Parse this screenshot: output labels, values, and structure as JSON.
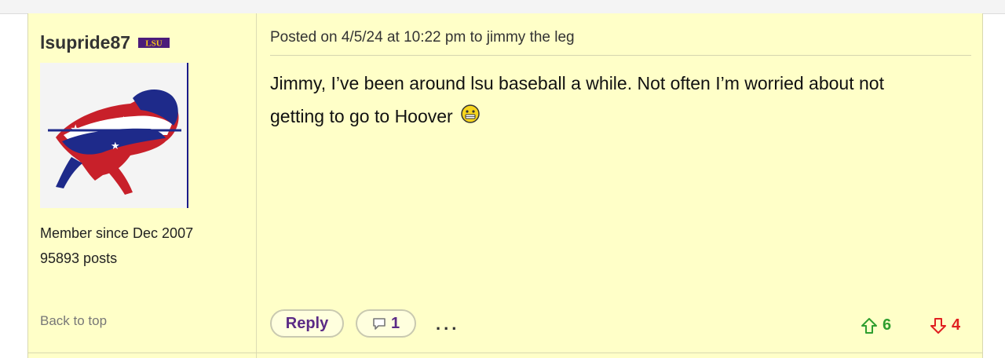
{
  "post": {
    "user": {
      "username": "lsupride87",
      "team_badge_text": "LSU",
      "member_since": "Member since Dec 2007",
      "posts": "95893 posts",
      "back_to_top": "Back to top",
      "avatar_icon": "buffalo-flag-avatar"
    },
    "header": "Posted on 4/5/24 at 10:22 pm to jimmy the leg",
    "body_line1": "Jimmy, I’ve been around lsu baseball a while. Not often I’m worried about not",
    "body_line2": "getting to go to Hoover",
    "emoji_icon": "grimace-emoji-icon",
    "actions": {
      "reply_label": "Reply",
      "comment_count": "1",
      "more_label": "...",
      "upvotes": "6",
      "downvotes": "4"
    },
    "colors": {
      "post_bg": "#ffffc8",
      "accent_purple": "#5b2a86",
      "up_green": "#2f9e2f",
      "down_red": "#e02020"
    }
  }
}
